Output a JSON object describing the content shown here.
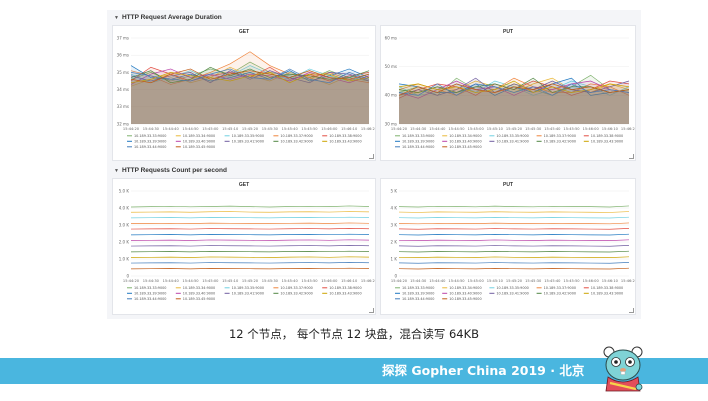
{
  "sections": [
    {
      "title": "HTTP Request Average Duration"
    },
    {
      "title": "HTTP Requests Count per second"
    }
  ],
  "icons": {
    "row_toggle": "chevron-down-icon",
    "mascot": "gopher-mascot-icon"
  },
  "legend_entries": [
    "10.189.33.33:9000",
    "10.189.33.34:9000",
    "10.189.33.35:9000",
    "10.189.33.37:9000",
    "10.189.33.38:9000",
    "10.189.33.39:9000",
    "10.189.33.40:9000",
    "10.189.33.41:9000",
    "10.189.33.42:9000",
    "10.189.33.43:9000",
    "10.189.33.44:9000",
    "10.189.33.45:9000"
  ],
  "series_colors": [
    "#7eb26d",
    "#eab839",
    "#6ed0e0",
    "#ef843c",
    "#e24d42",
    "#1f78c1",
    "#ba43a9",
    "#705da0",
    "#508642",
    "#cca300",
    "#447ebc",
    "#c15c17"
  ],
  "x_ticks_a": [
    "15:44:20",
    "15:44:30",
    "15:44:40",
    "15:44:50",
    "15:45:00",
    "15:45:10",
    "15:45:20",
    "15:45:30",
    "15:45:40",
    "15:45:50",
    "15:46:00",
    "15:46:10",
    "15:46:20"
  ],
  "x_ticks_b": [
    "15:44:20",
    "15:44:30",
    "15:44:40",
    "15:44:50",
    "15:45:00",
    "15:45:10",
    "15:45:20",
    "15:45:30",
    "15:45:40",
    "15:45:50",
    "15:46:00",
    "15:46:10",
    "15:46:20"
  ],
  "chart_data": [
    {
      "type": "area",
      "title": "GET",
      "y_ticks": [
        "37 ms",
        "36 ms",
        "35 ms",
        "34 ms",
        "33 ms",
        "32 ms"
      ],
      "ylim": [
        32,
        37
      ],
      "x": [
        "15:44:20",
        "15:44:30",
        "15:44:40",
        "15:44:50",
        "15:45:00",
        "15:45:10",
        "15:45:20",
        "15:45:30",
        "15:45:40",
        "15:45:50",
        "15:46:00",
        "15:46:10",
        "15:46:20"
      ],
      "legend": "bottom",
      "series": [
        {
          "values": [
            34.6,
            35.0,
            34.5,
            34.8,
            35.2,
            34.9,
            35.6,
            35.0,
            34.8,
            34.6,
            35.1,
            34.7,
            34.5
          ]
        },
        {
          "values": [
            34.2,
            34.6,
            34.9,
            34.4,
            34.7,
            35.3,
            34.8,
            34.5,
            35.0,
            34.7,
            34.3,
            34.8,
            34.6
          ]
        },
        {
          "values": [
            34.9,
            34.4,
            34.7,
            35.1,
            34.6,
            34.8,
            35.4,
            34.9,
            34.6,
            35.2,
            34.8,
            34.5,
            34.9
          ]
        },
        {
          "values": [
            35.1,
            34.8,
            34.3,
            34.6,
            35.0,
            35.5,
            36.2,
            35.4,
            34.9,
            34.7,
            35.0,
            34.6,
            34.4
          ]
        },
        {
          "values": [
            34.5,
            35.3,
            34.9,
            34.5,
            34.8,
            35.0,
            34.7,
            35.3,
            34.6,
            34.9,
            34.5,
            34.8,
            35.0
          ]
        },
        {
          "values": [
            35.4,
            34.7,
            34.6,
            34.9,
            34.5,
            34.7,
            35.0,
            34.6,
            35.1,
            34.5,
            34.8,
            35.2,
            34.7
          ]
        },
        {
          "values": [
            34.3,
            34.9,
            35.2,
            34.7,
            34.9,
            34.6,
            34.9,
            34.8,
            34.5,
            35.0,
            34.7,
            34.4,
            34.8
          ]
        },
        {
          "values": [
            34.8,
            34.5,
            34.8,
            35.0,
            34.4,
            35.1,
            34.6,
            35.1,
            34.7,
            34.4,
            35.0,
            34.9,
            34.5
          ]
        },
        {
          "values": [
            34.7,
            35.1,
            34.4,
            34.6,
            35.3,
            34.8,
            35.2,
            34.7,
            34.9,
            34.8,
            34.6,
            34.7,
            35.1
          ]
        },
        {
          "values": [
            34.4,
            34.6,
            35.0,
            34.8,
            34.7,
            34.5,
            34.8,
            35.0,
            34.4,
            34.9,
            34.9,
            34.5,
            34.7
          ]
        },
        {
          "values": [
            35.0,
            34.8,
            34.6,
            34.5,
            34.9,
            35.2,
            34.7,
            34.6,
            35.2,
            34.6,
            34.4,
            35.0,
            34.6
          ]
        },
        {
          "values": [
            34.6,
            34.4,
            34.9,
            35.2,
            34.6,
            34.9,
            35.1,
            34.9,
            34.7,
            35.1,
            34.7,
            34.6,
            34.9
          ]
        }
      ]
    },
    {
      "type": "area",
      "title": "PUT",
      "y_ticks": [
        "60 ms",
        "50 ms",
        "40 ms",
        "30 ms"
      ],
      "ylim": [
        30,
        60
      ],
      "x": [
        "15:44:20",
        "15:44:30",
        "15:44:40",
        "15:44:50",
        "15:45:00",
        "15:45:10",
        "15:45:20",
        "15:45:30",
        "15:45:40",
        "15:45:50",
        "15:46:00",
        "15:46:10",
        "15:46:20"
      ],
      "legend": "bottom",
      "series": [
        {
          "values": [
            41,
            43,
            40,
            46,
            42,
            41,
            44,
            42,
            40,
            43,
            47,
            42,
            41
          ]
        },
        {
          "values": [
            40,
            41,
            43,
            42,
            45,
            43,
            41,
            44,
            46,
            42,
            41,
            44,
            42
          ]
        },
        {
          "values": [
            43,
            40,
            41,
            44,
            41,
            45,
            43,
            40,
            42,
            45,
            43,
            40,
            43
          ]
        },
        {
          "values": [
            42,
            44,
            42,
            40,
            43,
            42,
            46,
            43,
            41,
            41,
            44,
            43,
            40
          ]
        },
        {
          "values": [
            39,
            42,
            44,
            43,
            40,
            44,
            42,
            45,
            43,
            40,
            42,
            45,
            44
          ]
        },
        {
          "values": [
            44,
            43,
            41,
            41,
            44,
            40,
            43,
            41,
            44,
            46,
            40,
            41,
            42
          ]
        },
        {
          "values": [
            41,
            39,
            42,
            45,
            42,
            43,
            40,
            43,
            42,
            44,
            45,
            42,
            41
          ]
        },
        {
          "values": [
            40,
            42,
            40,
            42,
            46,
            41,
            44,
            42,
            45,
            42,
            41,
            43,
            45
          ]
        },
        {
          "values": [
            42,
            41,
            43,
            41,
            43,
            44,
            42,
            46,
            41,
            43,
            43,
            41,
            42
          ]
        },
        {
          "values": [
            43,
            44,
            42,
            43,
            41,
            42,
            45,
            41,
            43,
            41,
            42,
            44,
            43
          ]
        },
        {
          "values": [
            41,
            40,
            44,
            40,
            44,
            43,
            41,
            43,
            40,
            44,
            41,
            42,
            41
          ]
        },
        {
          "values": [
            40,
            43,
            41,
            44,
            42,
            41,
            43,
            42,
            44,
            42,
            43,
            41,
            42
          ]
        }
      ]
    },
    {
      "type": "line",
      "title": "GET",
      "y_ticks": [
        "5.0 K",
        "4.0 K",
        "3.0 K",
        "2.0 K",
        "1.0 K",
        "0"
      ],
      "ylim": [
        0,
        5000
      ],
      "x": [
        "15:44:20",
        "15:44:30",
        "15:44:40",
        "15:44:50",
        "15:45:00",
        "15:45:10",
        "15:45:20",
        "15:45:30",
        "15:45:40",
        "15:45:50",
        "15:46:00",
        "15:46:10",
        "15:46:20"
      ],
      "legend": "bottom",
      "series": [
        {
          "values": [
            4060,
            4080,
            4100,
            4070,
            4090,
            4110,
            4080,
            4060,
            4090,
            4100,
            4080,
            4120,
            4090
          ]
        },
        {
          "values": [
            3750,
            3760,
            3770,
            3750,
            3780,
            3790,
            3760,
            3750,
            3770,
            3780,
            3760,
            3790,
            3770
          ]
        },
        {
          "values": [
            3420,
            3430,
            3440,
            3420,
            3450,
            3440,
            3430,
            3420,
            3440,
            3450,
            3430,
            3460,
            3440
          ]
        },
        {
          "values": [
            3080,
            3090,
            3100,
            3080,
            3110,
            3100,
            3090,
            3080,
            3100,
            3110,
            3090,
            3120,
            3100
          ]
        },
        {
          "values": [
            2760,
            2770,
            2780,
            2760,
            2790,
            2780,
            2770,
            2760,
            2780,
            2790,
            2770,
            2800,
            2780
          ]
        },
        {
          "values": [
            2420,
            2430,
            2440,
            2420,
            2450,
            2440,
            2430,
            2420,
            2440,
            2450,
            2430,
            2460,
            2440
          ]
        },
        {
          "values": [
            2090,
            2100,
            2110,
            2090,
            2120,
            2110,
            2100,
            2090,
            2110,
            2120,
            2100,
            2130,
            2110
          ]
        },
        {
          "values": [
            1760,
            1770,
            1780,
            1760,
            1790,
            1780,
            1770,
            1760,
            1780,
            1790,
            1770,
            1800,
            1780
          ]
        },
        {
          "values": [
            1420,
            1430,
            1440,
            1420,
            1450,
            1440,
            1430,
            1420,
            1440,
            1450,
            1430,
            1460,
            1440
          ]
        },
        {
          "values": [
            1090,
            1100,
            1110,
            1090,
            1120,
            1110,
            1100,
            1090,
            1110,
            1120,
            1100,
            1130,
            1110
          ]
        },
        {
          "values": [
            760,
            770,
            780,
            760,
            790,
            780,
            770,
            760,
            780,
            790,
            770,
            800,
            780
          ]
        },
        {
          "values": [
            420,
            430,
            440,
            420,
            450,
            440,
            430,
            420,
            440,
            450,
            430,
            460,
            440
          ]
        }
      ]
    },
    {
      "type": "line",
      "title": "PUT",
      "y_ticks": [
        "5 K",
        "4 K",
        "3 K",
        "2 K",
        "1 K",
        "0"
      ],
      "ylim": [
        0,
        5000
      ],
      "x": [
        "15:44:20",
        "15:44:30",
        "15:44:40",
        "15:44:50",
        "15:45:00",
        "15:45:10",
        "15:45:20",
        "15:45:30",
        "15:45:40",
        "15:45:50",
        "15:46:00",
        "15:46:10",
        "15:46:20"
      ],
      "legend": "bottom",
      "series": [
        {
          "values": [
            4080,
            4060,
            4100,
            4090,
            4070,
            4110,
            4080,
            4070,
            4100,
            4090,
            4080,
            4060,
            4120
          ]
        },
        {
          "values": [
            3760,
            3740,
            3770,
            3760,
            3750,
            3780,
            3760,
            3750,
            3770,
            3760,
            3750,
            3740,
            3790
          ]
        },
        {
          "values": [
            3430,
            3410,
            3440,
            3430,
            3420,
            3450,
            3430,
            3420,
            3440,
            3430,
            3420,
            3410,
            3460
          ]
        },
        {
          "values": [
            3090,
            3070,
            3100,
            3090,
            3080,
            3110,
            3090,
            3080,
            3100,
            3090,
            3080,
            3070,
            3120
          ]
        },
        {
          "values": [
            2770,
            2750,
            2780,
            2770,
            2760,
            2790,
            2770,
            2760,
            2780,
            2770,
            2760,
            2750,
            2800
          ]
        },
        {
          "values": [
            2430,
            2410,
            2440,
            2430,
            2420,
            2450,
            2430,
            2420,
            2440,
            2430,
            2420,
            2410,
            2460
          ]
        },
        {
          "values": [
            2100,
            2080,
            2110,
            2100,
            2090,
            2120,
            2100,
            2090,
            2110,
            2100,
            2090,
            2080,
            2130
          ]
        },
        {
          "values": [
            1770,
            1750,
            1780,
            1770,
            1760,
            1790,
            1770,
            1760,
            1780,
            1770,
            1760,
            1750,
            1800
          ]
        },
        {
          "values": [
            1430,
            1410,
            1440,
            1430,
            1420,
            1450,
            1430,
            1420,
            1440,
            1430,
            1420,
            1410,
            1460
          ]
        },
        {
          "values": [
            1100,
            1080,
            1110,
            1100,
            1090,
            1120,
            1100,
            1090,
            1110,
            1100,
            1090,
            1080,
            1130
          ]
        },
        {
          "values": [
            770,
            750,
            780,
            770,
            760,
            790,
            770,
            760,
            780,
            770,
            760,
            750,
            800
          ]
        },
        {
          "values": [
            430,
            410,
            440,
            430,
            420,
            450,
            430,
            420,
            440,
            430,
            420,
            410,
            460
          ]
        }
      ]
    }
  ],
  "caption": "12 个节点， 每个节点 12 块盘，混合读写 64KB",
  "footer": {
    "text": "探探 Gopher China 2019 · 北京"
  }
}
